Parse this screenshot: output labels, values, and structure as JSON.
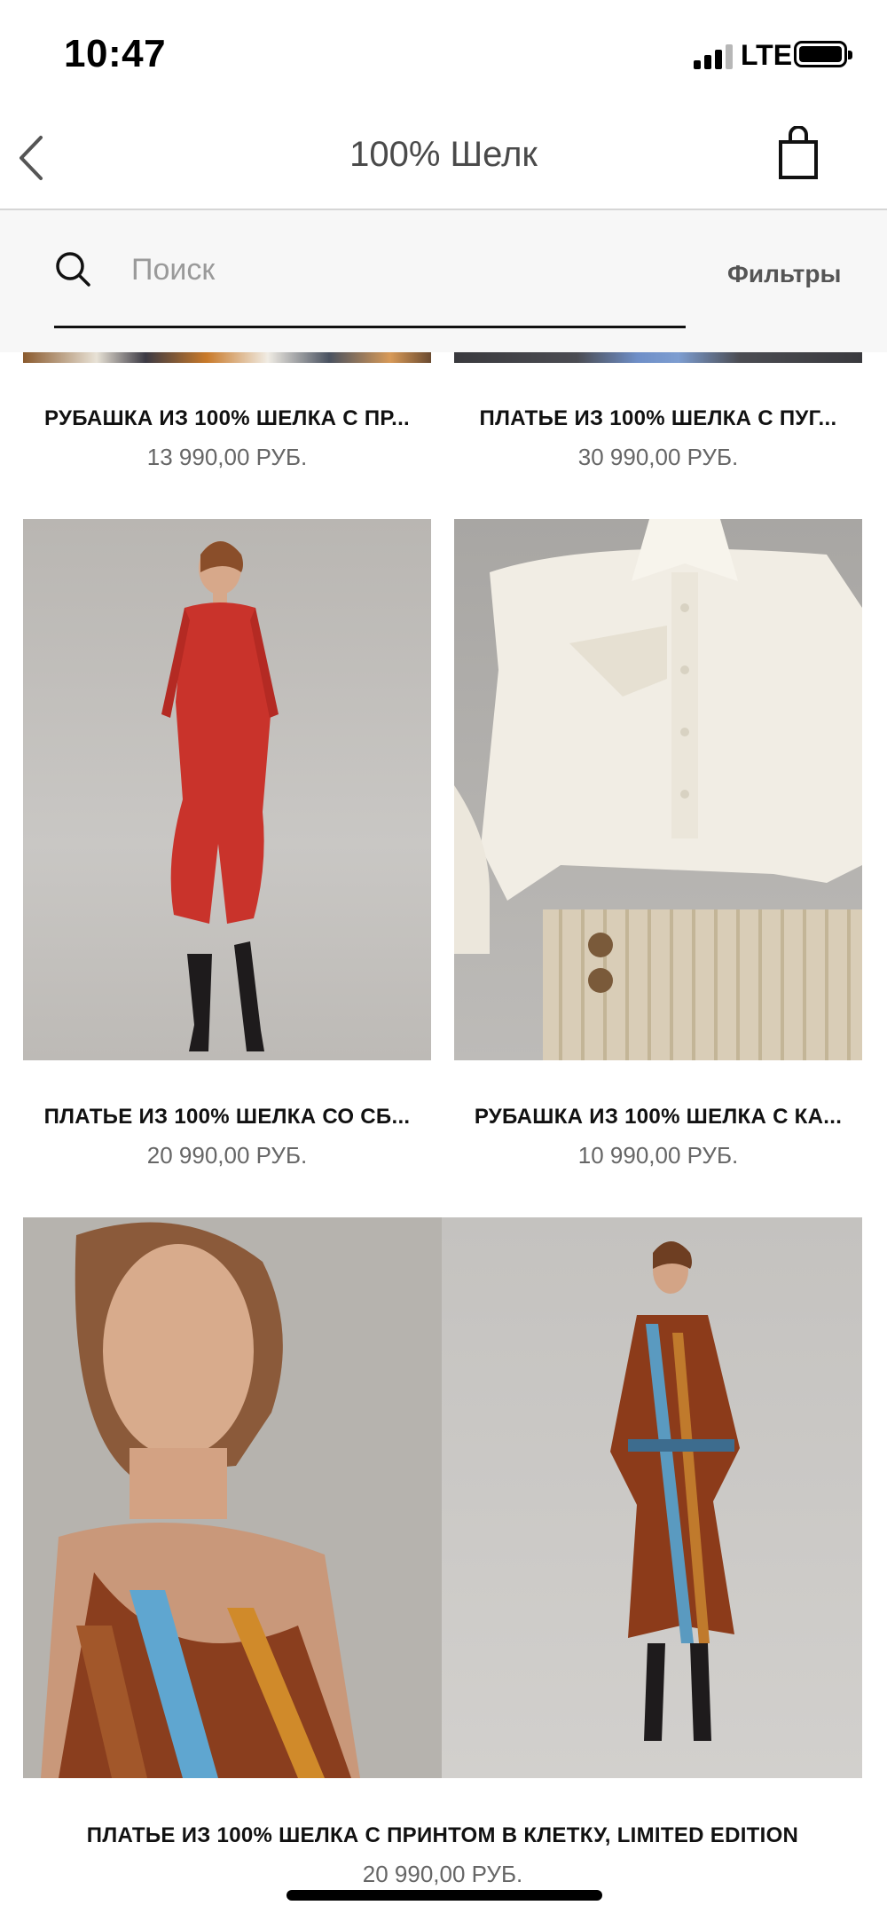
{
  "status_bar": {
    "time": "10:47",
    "network": "LTE"
  },
  "nav": {
    "title": "100% Шелк",
    "back_icon": "chevron-left-icon",
    "cart_icon": "shopping-bag-icon"
  },
  "search": {
    "placeholder": "Поиск",
    "value": "",
    "filters_label": "Фильтры"
  },
  "products": [
    {
      "name": "РУБАШКА ИЗ 100% ШЕЛКА С ПР...",
      "price": "13 990,00  РУБ."
    },
    {
      "name": "ПЛАТЬЕ ИЗ 100% ШЕЛКА С ПУГ...",
      "price": "30 990,00  РУБ."
    },
    {
      "name": "ПЛАТЬЕ ИЗ 100% ШЕЛКА СО СБ...",
      "price": "20 990,00  РУБ."
    },
    {
      "name": "РУБАШКА ИЗ 100% ШЕЛКА С КА...",
      "price": "10 990,00  РУБ."
    },
    {
      "name": "ПЛАТЬЕ ИЗ 100% ШЕЛКА С ПРИНТОМ В КЛЕТКУ, LIMITED EDITION",
      "price": "20 990,00  РУБ."
    }
  ],
  "colors": {
    "accent": "#111111",
    "price": "#666666",
    "background": "#ffffff",
    "search_bg": "#f7f7f7"
  }
}
